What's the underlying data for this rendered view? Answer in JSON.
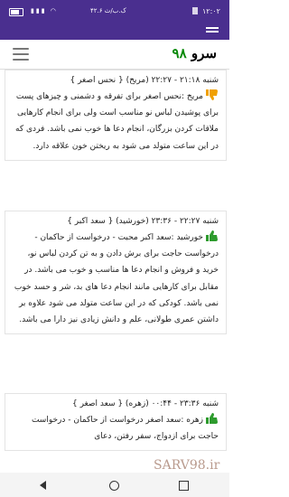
{
  "status_bar": {
    "time": "۱۲:۰۲",
    "network_speed": "۴۲.۶ ک.ب/ث",
    "icons": [
      "wifi-icon",
      "signal-icon",
      "battery-icon"
    ]
  },
  "header": {
    "brand_name": "سرو",
    "brand_number": "۹۸",
    "brand_number_color": "#0b8a0b"
  },
  "entries": [
    {
      "title": "شنبه ۲۱:۱۸ - ۲۲:۲۷ (مریخ) { نحس اصغر }",
      "thumb": "down",
      "thumb_color": "#f0a000",
      "body": "مریخ :نحس اصغر برای تفرقه و دشمنی و چیزهای پست برای پوشیدن لباس نو مناسب است ولی برای انجام کارهایی ملاقات کردن بزرگان، انجام دعا ها خوب نمی باشد. فردی که در این ساعت متولد می شود به ریختن خون علاقه دارد."
    },
    {
      "title": "شنبه ۲۲:۲۷ - ۲۳:۳۶ (خورشید) { سعد اکبر }",
      "thumb": "up",
      "thumb_color": "#2e9b2e",
      "body": "خورشید :سعد اکبر محبت - درخواست از حاکمان - درخواست حاجت برای برش دادن و به تن کردن لباس نو، خرید و فروش و انجام دعا ها مناسب و خوب می باشد. در مقابل برای کارهایی مانند انجام دعا های بد، شر و حسد خوب نمی باشد. کودکی که در این ساعت متولد می شود علاوه بر داشتن عمری طولانی، علم و دانش زیادی نیز دارا می باشد."
    },
    {
      "title": "شنبه ۲۳:۳۶ - ۰۰:۴۴ (زهره) { سعد اصغر }",
      "thumb": "up",
      "thumb_color": "#2e9b2e",
      "body": "زهره :سعد اصغر درخواست از حاکمان - درخواست حاجت برای ازدواج، سفر رفتن، دعای"
    }
  ],
  "watermark": "SARV98.ir"
}
